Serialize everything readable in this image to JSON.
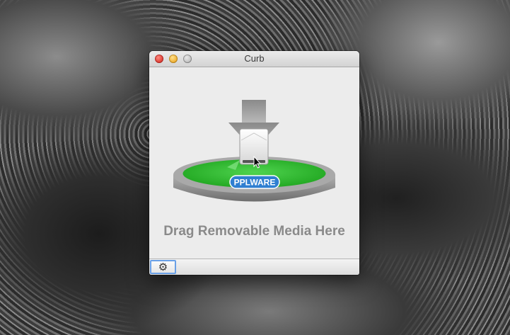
{
  "window": {
    "title": "Curb"
  },
  "artwork": {
    "badge_text": "PPLWARE",
    "platform_color": "#2bb82b",
    "badge_color": "#2f7fd1"
  },
  "main": {
    "drop_label": "Drag Removable Media Here"
  },
  "toolbar": {
    "settings_icon": "gear-icon"
  }
}
